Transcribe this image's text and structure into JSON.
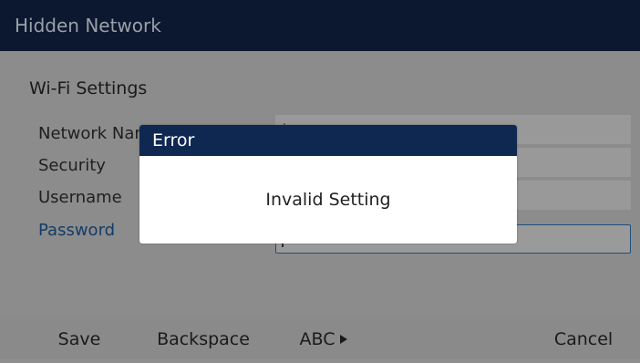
{
  "window": {
    "title": "Hidden Network"
  },
  "settings": {
    "section_title": "Wi-Fi Settings",
    "rows": [
      {
        "label": "Network Name",
        "value": ""
      },
      {
        "label": "Security",
        "value": ""
      },
      {
        "label": "Username",
        "value": ""
      },
      {
        "label": "Password",
        "value": ""
      }
    ],
    "active_row": "Password"
  },
  "dialog": {
    "title": "Error",
    "message": "Invalid Setting"
  },
  "softkeys": {
    "save": "Save",
    "backspace": "Backspace",
    "abc": "ABC",
    "abc_icon": "triangle-right-icon",
    "cancel": "Cancel"
  },
  "colors": {
    "titlebar_bg": "#0c1830",
    "dialog_title_bg": "#0f2852",
    "active_label": "#143c68",
    "overlay_bg": "#8c8c8c"
  }
}
